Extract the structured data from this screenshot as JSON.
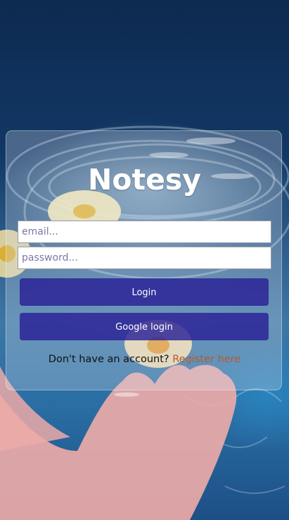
{
  "app": {
    "brand": "Notesy"
  },
  "form": {
    "email_placeholder": "email...",
    "email_value": "",
    "password_placeholder": "password...",
    "password_value": "",
    "login_label": "Login",
    "google_login_label": "Google login",
    "register_prompt": "Don't have an account?",
    "register_link_label": "Register here"
  },
  "colors": {
    "button_bg": "#2a2096",
    "link": "#b35b2e",
    "brand_text": "#ffffff"
  }
}
